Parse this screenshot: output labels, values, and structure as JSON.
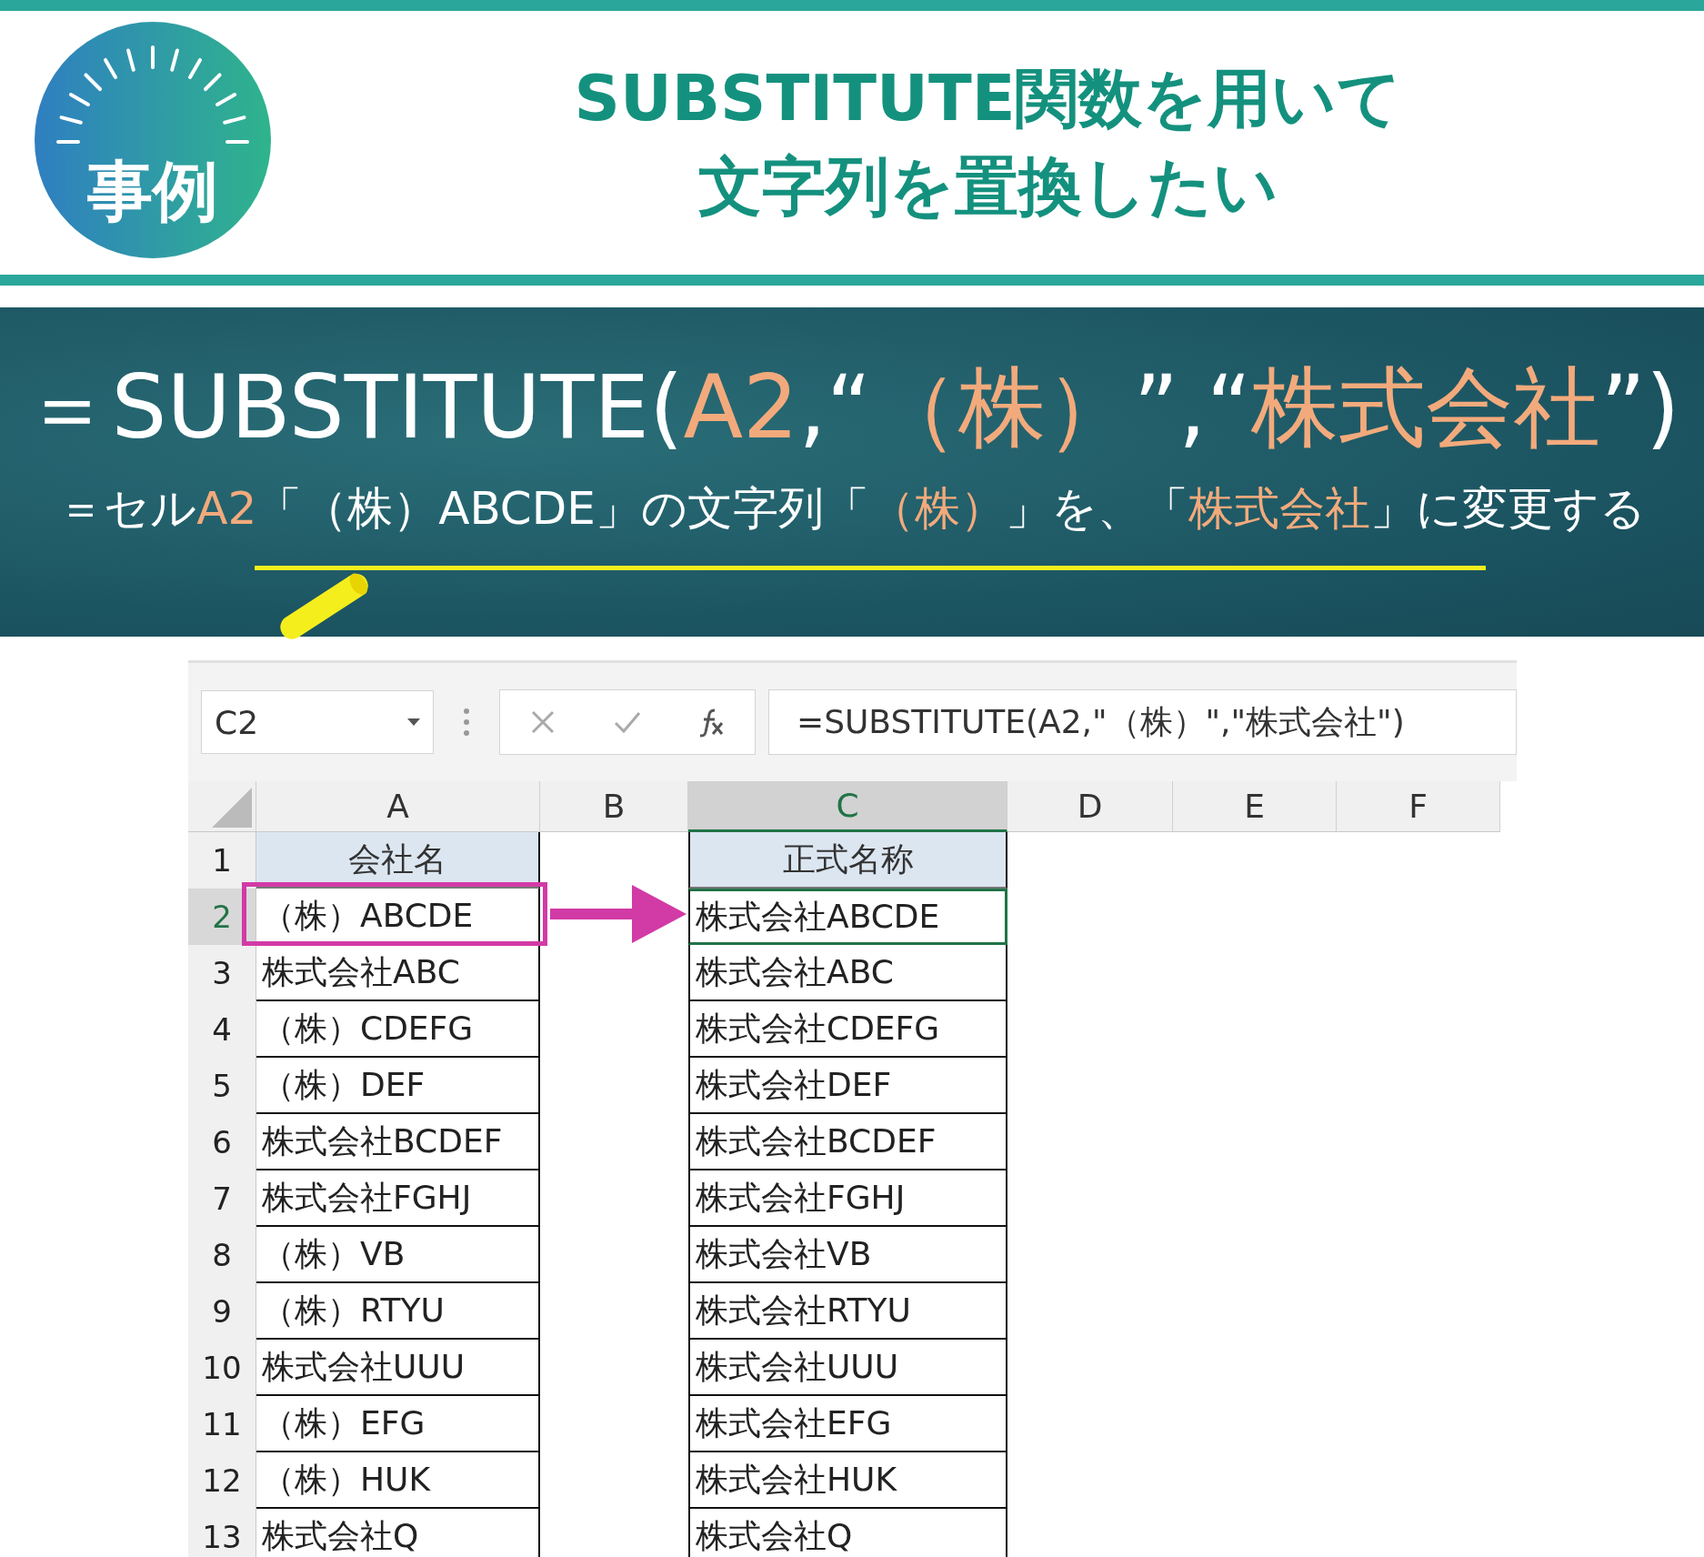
{
  "badge": {
    "label": "事例"
  },
  "title_lines": [
    "SUBSTITUTE関数を用いて",
    "文字列を置換したい"
  ],
  "formula": [
    {
      "text": "＝SUBSTITUTE(",
      "accent": false
    },
    {
      "text": "A2",
      "accent": true
    },
    {
      "text": ",“",
      "accent": false
    },
    {
      "text": "（株）",
      "accent": true
    },
    {
      "text": "”,“",
      "accent": false
    },
    {
      "text": "株式会社",
      "accent": true
    },
    {
      "text": "”)",
      "accent": false
    }
  ],
  "explanation": [
    {
      "text": "＝セル",
      "accent": false
    },
    {
      "text": "A2",
      "accent": true
    },
    {
      "text": "「（株）ABCDE」の文字列「",
      "accent": false
    },
    {
      "text": "（株）",
      "accent": true
    },
    {
      "text": "」を、「",
      "accent": false
    },
    {
      "text": "株式会社",
      "accent": true
    },
    {
      "text": "」に変更する",
      "accent": false
    }
  ],
  "spreadsheet": {
    "name_box": "C2",
    "formula": "=SUBSTITUTE(A2,\"（株）\",\"株式会社\")",
    "columns": [
      {
        "label": "A",
        "selected": false
      },
      {
        "label": "B",
        "selected": false
      },
      {
        "label": "C",
        "selected": true
      },
      {
        "label": "D",
        "selected": false
      },
      {
        "label": "E",
        "selected": false
      },
      {
        "label": "F",
        "selected": false
      }
    ],
    "rows": [
      {
        "number": "1",
        "selected": false,
        "kind": "header",
        "a": "会社名",
        "c": "正式名称"
      },
      {
        "number": "2",
        "selected": true,
        "kind": "data",
        "a": "（株）ABCDE",
        "c": "株式会社ABCDE"
      },
      {
        "number": "3",
        "selected": false,
        "kind": "data",
        "a": "株式会社ABC",
        "c": "株式会社ABC"
      },
      {
        "number": "4",
        "selected": false,
        "kind": "data",
        "a": "（株）CDEFG",
        "c": "株式会社CDEFG"
      },
      {
        "number": "5",
        "selected": false,
        "kind": "data",
        "a": "（株）DEF",
        "c": "株式会社DEF"
      },
      {
        "number": "6",
        "selected": false,
        "kind": "data",
        "a": "株式会社BCDEF",
        "c": "株式会社BCDEF"
      },
      {
        "number": "7",
        "selected": false,
        "kind": "data",
        "a": "株式会社FGHJ",
        "c": "株式会社FGHJ"
      },
      {
        "number": "8",
        "selected": false,
        "kind": "data",
        "a": "（株）VB",
        "c": "株式会社VB"
      },
      {
        "number": "9",
        "selected": false,
        "kind": "data",
        "a": "（株）RTYU",
        "c": "株式会社RTYU"
      },
      {
        "number": "10",
        "selected": false,
        "kind": "data",
        "a": "株式会社UUU",
        "c": "株式会社UUU"
      },
      {
        "number": "11",
        "selected": false,
        "kind": "data",
        "a": "（株）EFG",
        "c": "株式会社EFG"
      },
      {
        "number": "12",
        "selected": false,
        "kind": "data",
        "a": "（株）HUK",
        "c": "株式会社HUK"
      },
      {
        "number": "13",
        "selected": false,
        "kind": "data",
        "a": "株式会社Q",
        "c": "株式会社Q"
      }
    ]
  }
}
